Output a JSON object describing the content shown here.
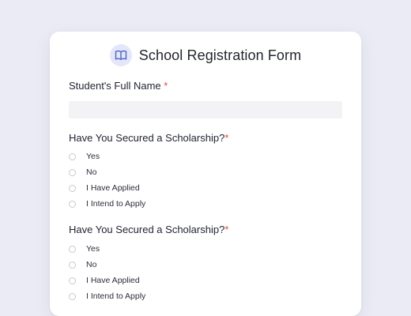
{
  "form": {
    "title": "School Registration Form",
    "icon": "book-icon",
    "accent_color": "#4f63c8",
    "required_color": "#e34848",
    "full_name": {
      "label": "Student's Full Name",
      "required_mark": "*",
      "value": "",
      "placeholder": ""
    },
    "questions": [
      {
        "label": "Have You Secured a Scholarship?",
        "required_mark": "*",
        "options": [
          "Yes",
          "No",
          "I Have Applied",
          "I Intend to Apply"
        ]
      },
      {
        "label": "Have You Secured a Scholarship?",
        "required_mark": "*",
        "options": [
          "Yes",
          "No",
          "I Have Applied",
          "I Intend to Apply"
        ]
      }
    ]
  }
}
